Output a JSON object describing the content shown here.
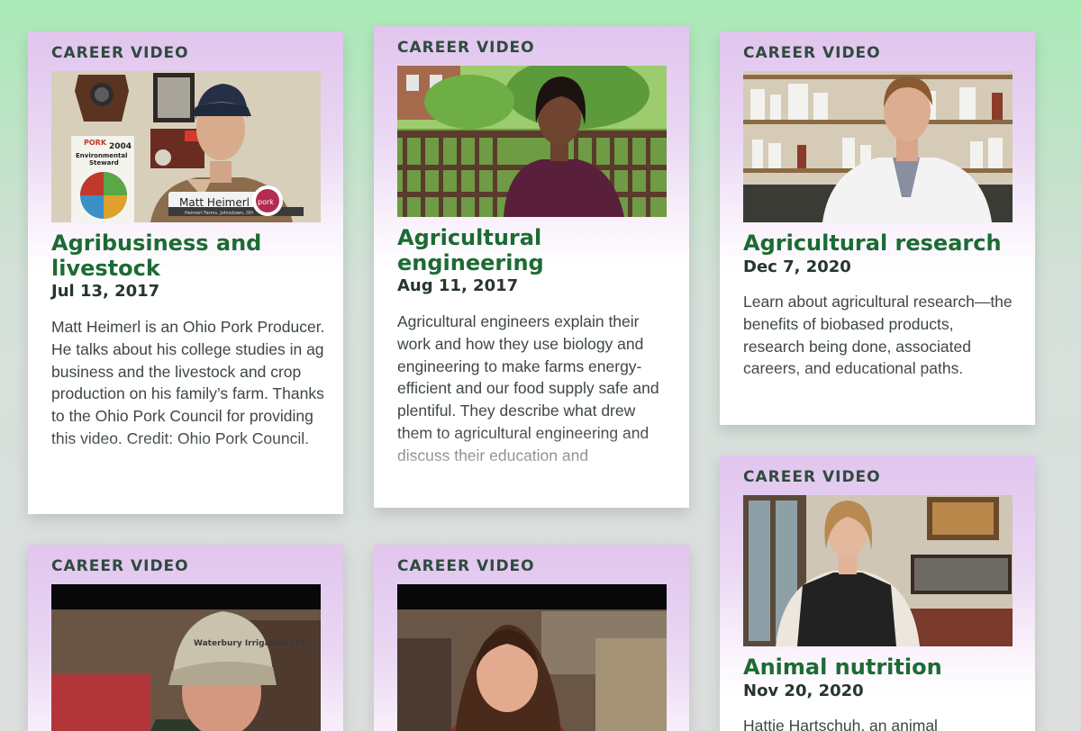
{
  "cards": [
    {
      "label": "CAREER VIDEO",
      "title": "Agribusiness and livestock",
      "date": "Jul 13, 2017",
      "description": "Matt Heimerl is an Ohio Pork Producer. He talks about his college studies in ag business and the livestock and crop production on his family’s farm. Thanks to the Ohio Pork Council for providing this video. Credit: Ohio Pork Council.",
      "thumb": {
        "name_caption": "Matt Heimerl",
        "sub_caption": "Heimerl Farms, Johnstown, OH",
        "badge": "pork",
        "poster_year": "2004",
        "poster_brand": "PORK",
        "poster_line1": "Environmental",
        "poster_line2": "Steward"
      }
    },
    {
      "label": "CAREER VIDEO",
      "title": "Agricultural engineering",
      "date": "Aug 11, 2017",
      "description": "Agricultural engineers explain their work and how they use biology and engineering to make farms energy-efficient and our food supply safe and plentiful. They describe what drew them to agricultural engineering and discuss their education and"
    },
    {
      "label": "CAREER VIDEO",
      "title": "Agricultural research",
      "date": "Dec 7, 2020",
      "description": "Learn about agricultural research—the benefits of biobased products, research being done, associated careers, and educational paths."
    },
    {
      "label": "CAREER VIDEO",
      "title": "Animal nutrition",
      "date": "Nov 20, 2020",
      "description": "Hattie Hartschuh, an animal"
    },
    {
      "label": "CAREER VIDEO",
      "thumb": {
        "cap_text": "Waterbury Irrigation LLC"
      }
    },
    {
      "label": "CAREER VIDEO"
    }
  ],
  "colors": {
    "page_top": "#a8eab6",
    "page_bottom": "#dcdede",
    "card_header": "#e1c5ee",
    "title_green": "#1c6b34",
    "label": "#2f4a3e",
    "date": "#27362d",
    "body_text": "#3d4743"
  }
}
